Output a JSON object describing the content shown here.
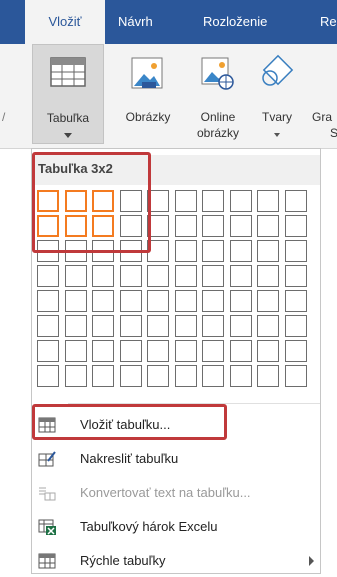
{
  "ribbon": {
    "tabs": [
      {
        "label": "Vložiť",
        "active": true
      },
      {
        "label": "Návrh",
        "active": false
      },
      {
        "label": "Rozloženie",
        "active": false
      },
      {
        "label": "Re",
        "active": false
      }
    ],
    "buttons": {
      "table": "Tabuľka",
      "pictures": "Obrázky",
      "online_line1": "Online",
      "online_line2": "obrázky",
      "shapes": "Tvary",
      "graph_partial": "Gra",
      "graph_partial2": "S"
    }
  },
  "dropdown": {
    "header": "Tabuľka 3x2",
    "grid": {
      "columns": 10,
      "rows": 8,
      "selected_columns": 3,
      "selected_rows": 2
    },
    "items": [
      {
        "label": "Vložiť tabuľku...",
        "icon": "table-grid-icon",
        "highlighted": true,
        "disabled": false
      },
      {
        "label": "Nakresliť tabuľku",
        "icon": "draw-table-icon",
        "highlighted": false,
        "disabled": false
      },
      {
        "label": "Konvertovať text na tabuľku...",
        "icon": "convert-text-icon",
        "highlighted": false,
        "disabled": true
      },
      {
        "label": "Tabuľkový hárok Excelu",
        "icon": "excel-sheet-icon",
        "highlighted": false,
        "disabled": false
      },
      {
        "label": "Rýchle tabuľky",
        "icon": "quick-tables-icon",
        "highlighted": false,
        "disabled": false,
        "submenu": true
      }
    ]
  },
  "colors": {
    "ribbon_blue": "#2b579a",
    "selection_orange": "#f47b20",
    "highlight_red": "#c0393b",
    "excel_green": "#1e7145"
  }
}
